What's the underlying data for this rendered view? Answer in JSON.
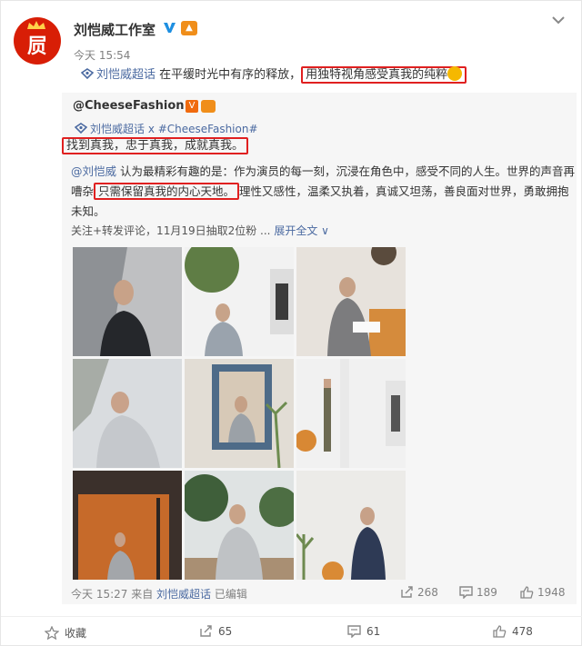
{
  "author": {
    "name": "刘恺威工作室",
    "time": "今天 15:54"
  },
  "post": {
    "topic": "刘恺威超话",
    "text_plain": " 在平缓时光中有序的释放，",
    "text_highlight": "用独特视角感受真我的纯粹"
  },
  "repost": {
    "user": "@CheeseFashion",
    "badge_v": "V",
    "topic_line": "刘恺威超话 x #CheeseFashion#",
    "slogan": "找到真我，忠于真我，成就真我。",
    "mention": "@刘恺威",
    "para_1": " 认为最精彩有趣的是：作为演员的每一刻，沉浸在角色中，感受不同的人生。世界的声音再嘈杂",
    "para_highlight": "只需保留真我的内心天地。",
    "para_2": "理性又感性，温柔又执着，真诚又坦荡，善良面对世界，勇敢拥抱未知。",
    "meta": "关注+转发评论，11月19日抽取2位粉 ... ",
    "expand": "展开全文",
    "expand_arrow": "∨",
    "footer": {
      "time": "今天 15:27 来自 ",
      "source": "刘恺威超话",
      "edited": " 已编辑",
      "reposts": "268",
      "comments": "189",
      "likes": "1948"
    }
  },
  "actions": {
    "favorite": "收藏",
    "repost": "65",
    "comment": "61",
    "like": "478"
  }
}
